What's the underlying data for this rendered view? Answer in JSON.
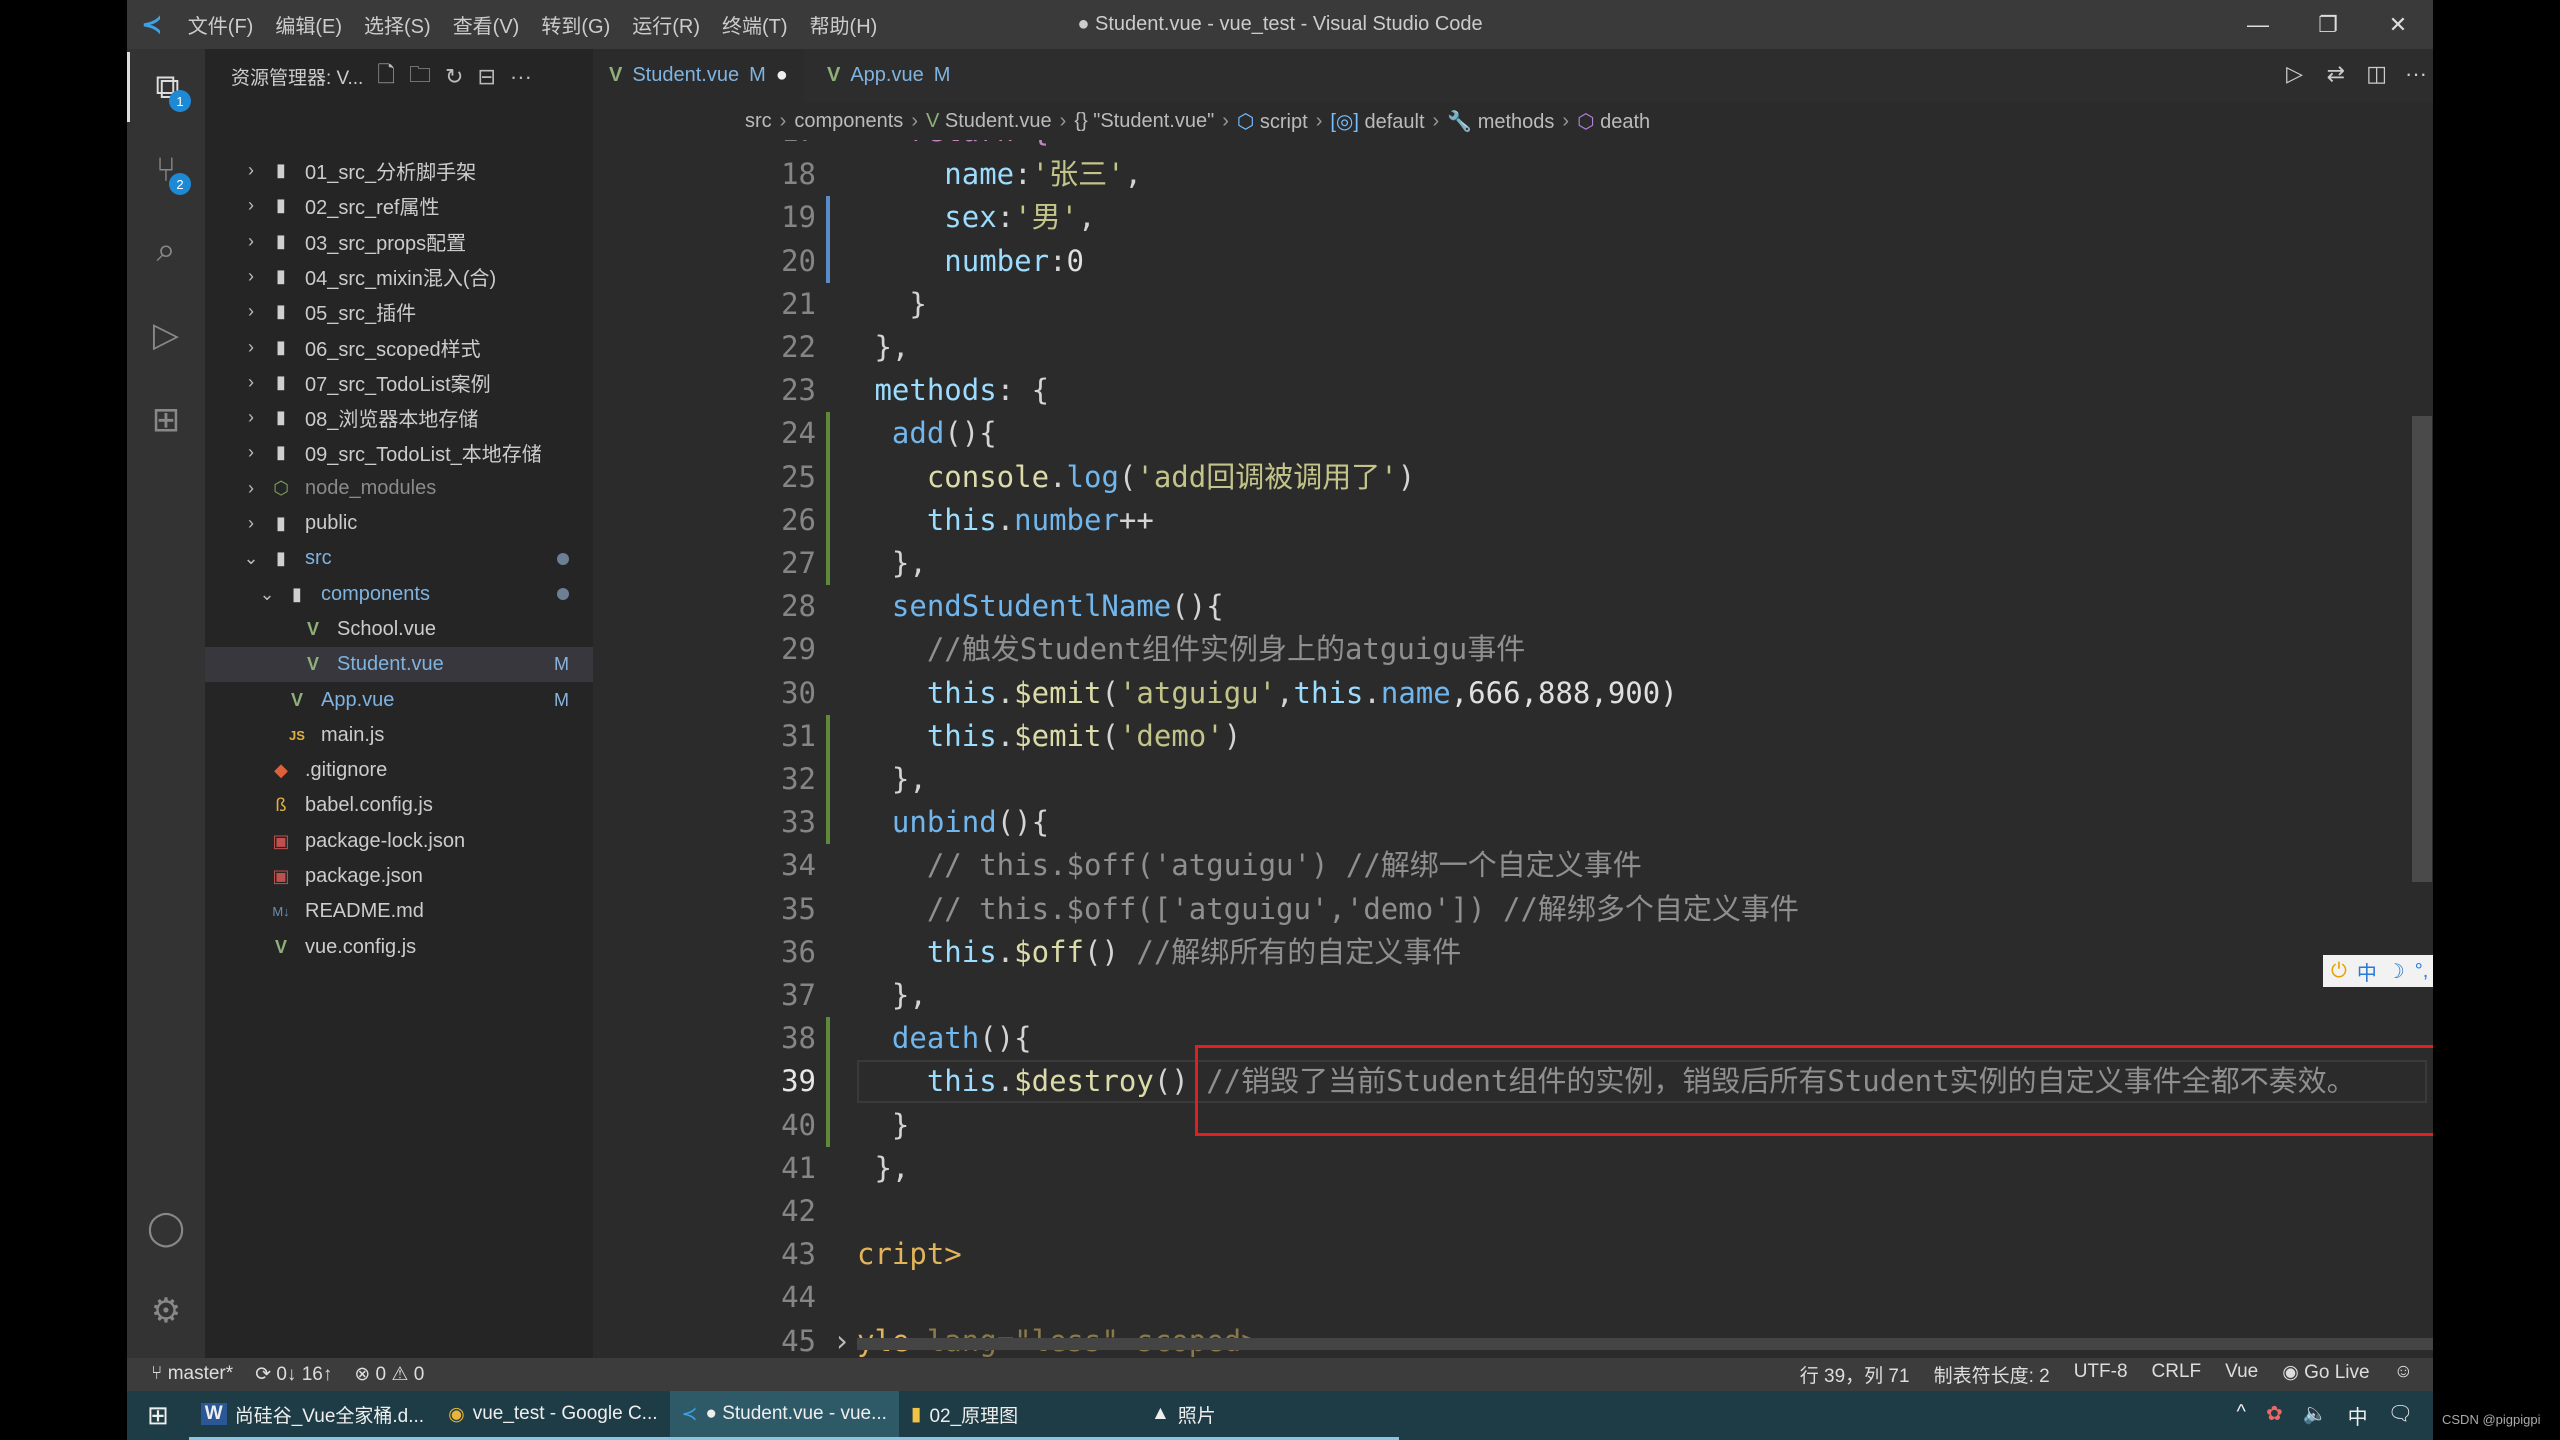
{
  "titlebar": {
    "menus": [
      "文件(F)",
      "编辑(E)",
      "选择(S)",
      "查看(V)",
      "转到(G)",
      "运行(R)",
      "终端(T)",
      "帮助(H)"
    ],
    "title": "● Student.vue - vue_test - Visual Studio Code"
  },
  "activity": {
    "explorer_badge": "1",
    "scm_badge": "2"
  },
  "sidebar": {
    "title": "资源管理器: V...",
    "items": [
      {
        "label": "01_src_分析脚手架",
        "type": "folder",
        "depth": 0
      },
      {
        "label": "02_src_ref属性",
        "type": "folder",
        "depth": 0
      },
      {
        "label": "03_src_props配置",
        "type": "folder",
        "depth": 0
      },
      {
        "label": "04_src_mixin混入(合)",
        "type": "folder",
        "depth": 0
      },
      {
        "label": "05_src_插件",
        "type": "folder",
        "depth": 0
      },
      {
        "label": "06_src_scoped样式",
        "type": "folder",
        "depth": 0
      },
      {
        "label": "07_src_TodoList案例",
        "type": "folder",
        "depth": 0
      },
      {
        "label": "08_浏览器本地存储",
        "type": "folder",
        "depth": 0
      },
      {
        "label": "09_src_TodoList_本地存储",
        "type": "folder",
        "depth": 0
      },
      {
        "label": "node_modules",
        "type": "node",
        "depth": 0
      },
      {
        "label": "public",
        "type": "folder",
        "depth": 0
      },
      {
        "label": "src",
        "type": "folder-open",
        "depth": 0,
        "dot": true
      },
      {
        "label": "components",
        "type": "folder-open",
        "depth": 1,
        "dot": true
      },
      {
        "label": "School.vue",
        "type": "vue",
        "depth": 2
      },
      {
        "label": "Student.vue",
        "type": "vue",
        "depth": 2,
        "mark": "M",
        "selected": true
      },
      {
        "label": "App.vue",
        "type": "vue",
        "depth": 1,
        "mark": "M"
      },
      {
        "label": "main.js",
        "type": "js",
        "depth": 1
      },
      {
        "label": ".gitignore",
        "type": "git",
        "depth": 0
      },
      {
        "label": "babel.config.js",
        "type": "babel",
        "depth": 0
      },
      {
        "label": "package-lock.json",
        "type": "json",
        "depth": 0
      },
      {
        "label": "package.json",
        "type": "json",
        "depth": 0
      },
      {
        "label": "README.md",
        "type": "md",
        "depth": 0
      },
      {
        "label": "vue.config.js",
        "type": "vue",
        "depth": 0
      }
    ]
  },
  "tabs": [
    {
      "label": "Student.vue",
      "mark": "M",
      "dirty": "●"
    },
    {
      "label": "App.vue",
      "mark": "M"
    }
  ],
  "breadcrumb": [
    "src",
    "components",
    "Student.vue",
    "{} \"Student.vue\"",
    "script",
    "default",
    "methods",
    "death"
  ],
  "editor": {
    "current_line": 39,
    "lines": [
      {
        "n": "17",
        "t": [
          [
            "   return {",
            "kw2"
          ]
        ]
      },
      {
        "n": "18",
        "t": [
          [
            "     name",
            "prop"
          ],
          [
            ":",
            "p"
          ],
          [
            "'张三'",
            "str"
          ],
          [
            ",",
            "p"
          ]
        ]
      },
      {
        "n": "19",
        "t": [
          [
            "     sex",
            "prop"
          ],
          [
            ":",
            "p"
          ],
          [
            "'男'",
            "str"
          ],
          [
            ",",
            "p"
          ]
        ]
      },
      {
        "n": "20",
        "t": [
          [
            "     number",
            "prop"
          ],
          [
            ":",
            "p"
          ],
          [
            "0",
            "num"
          ]
        ]
      },
      {
        "n": "21",
        "t": [
          [
            "   }",
            "p"
          ]
        ]
      },
      {
        "n": "22",
        "t": [
          [
            " },",
            "p"
          ]
        ]
      },
      {
        "n": "23",
        "t": [
          [
            " methods",
            "prop"
          ],
          [
            ": {",
            "p"
          ]
        ]
      },
      {
        "n": "24",
        "t": [
          [
            "  add",
            "meth"
          ],
          [
            "(){",
            "p"
          ]
        ]
      },
      {
        "n": "25",
        "t": [
          [
            "    console",
            "fn"
          ],
          [
            ".",
            "p"
          ],
          [
            "log",
            "meth"
          ],
          [
            "(",
            "p"
          ],
          [
            "'add回调被调用了'",
            "str"
          ],
          [
            ")",
            "p"
          ]
        ]
      },
      {
        "n": "26",
        "t": [
          [
            "    this",
            "kw"
          ],
          [
            ".",
            "p"
          ],
          [
            "number",
            "meth"
          ],
          [
            "++",
            "p"
          ]
        ]
      },
      {
        "n": "27",
        "t": [
          [
            "  },",
            "p"
          ]
        ]
      },
      {
        "n": "28",
        "t": [
          [
            "  sendStudentlName",
            "meth"
          ],
          [
            "(){",
            "p"
          ]
        ]
      },
      {
        "n": "29",
        "t": [
          [
            "    //触发Student组件实例身上的atguigu事件",
            "cmt"
          ]
        ]
      },
      {
        "n": "30",
        "t": [
          [
            "    this",
            "kw"
          ],
          [
            ".",
            "p"
          ],
          [
            "$emit",
            "fn"
          ],
          [
            "(",
            "p"
          ],
          [
            "'atguigu'",
            "str"
          ],
          [
            ",",
            "p"
          ],
          [
            "this",
            "kw"
          ],
          [
            ".",
            "p"
          ],
          [
            "name",
            "meth"
          ],
          [
            ",666,888,900)",
            "num"
          ]
        ]
      },
      {
        "n": "31",
        "t": [
          [
            "    this",
            "kw"
          ],
          [
            ".",
            "p"
          ],
          [
            "$emit",
            "fn"
          ],
          [
            "(",
            "p"
          ],
          [
            "'demo'",
            "str"
          ],
          [
            ")",
            "p"
          ]
        ]
      },
      {
        "n": "32",
        "t": [
          [
            "  },",
            "p"
          ]
        ]
      },
      {
        "n": "33",
        "t": [
          [
            "  unbind",
            "meth"
          ],
          [
            "(){",
            "p"
          ]
        ]
      },
      {
        "n": "34",
        "t": [
          [
            "    // this.$off('atguigu') //解绑一个自定义事件",
            "cmt"
          ]
        ]
      },
      {
        "n": "35",
        "t": [
          [
            "    // this.$off(['atguigu','demo']) //解绑多个自定义事件",
            "cmt"
          ]
        ]
      },
      {
        "n": "36",
        "t": [
          [
            "    this",
            "kw"
          ],
          [
            ".",
            "p"
          ],
          [
            "$off",
            "fn"
          ],
          [
            "() ",
            "p"
          ],
          [
            "//解绑所有的自定义事件",
            "cmt"
          ]
        ]
      },
      {
        "n": "37",
        "t": [
          [
            "  },",
            "p"
          ]
        ]
      },
      {
        "n": "38",
        "t": [
          [
            "  death",
            "meth"
          ],
          [
            "(){",
            "p"
          ]
        ]
      },
      {
        "n": "39",
        "t": [
          [
            "    this",
            "kw"
          ],
          [
            ".",
            "p"
          ],
          [
            "$destroy",
            "fn"
          ],
          [
            "() ",
            "p"
          ],
          [
            "//销毁了当前Student组件的实例，销毁后所有Student实例的自定义事件全都不奏效。",
            "cmt"
          ]
        ]
      },
      {
        "n": "40",
        "t": [
          [
            "  }",
            "p"
          ]
        ]
      },
      {
        "n": "41",
        "t": [
          [
            " },",
            "p"
          ]
        ]
      },
      {
        "n": "42",
        "t": []
      },
      {
        "n": "43",
        "t": [
          [
            "cript>",
            "tag"
          ]
        ]
      },
      {
        "n": "44",
        "t": []
      },
      {
        "n": "45",
        "t": [
          [
            "yle",
            "tag"
          ],
          [
            " lang=\"less\" scoped>",
            "dim"
          ],
          [
            " ···",
            "cmt"
          ]
        ]
      }
    ]
  },
  "ime": {
    "items": [
      "中",
      "☽",
      "°,",
      "⌨",
      "👤",
      "🔧"
    ]
  },
  "statusbar": {
    "branch": "master*",
    "sync": "0↓ 16↑",
    "errors": "0",
    "warnings": "0",
    "position": "行 39，列 71",
    "tab_size": "制表符长度: 2",
    "encoding": "UTF-8",
    "eol": "CRLF",
    "language": "Vue",
    "golive": "Go Live"
  },
  "taskbar": {
    "apps": [
      "尚硅谷_Vue全家桶.d...",
      "vue_test - Google C...",
      "● Student.vue - vue...",
      "02_原理图",
      "照片"
    ],
    "tray": [
      "^",
      "中"
    ]
  },
  "watermark": "CSDN @pigpigpi"
}
